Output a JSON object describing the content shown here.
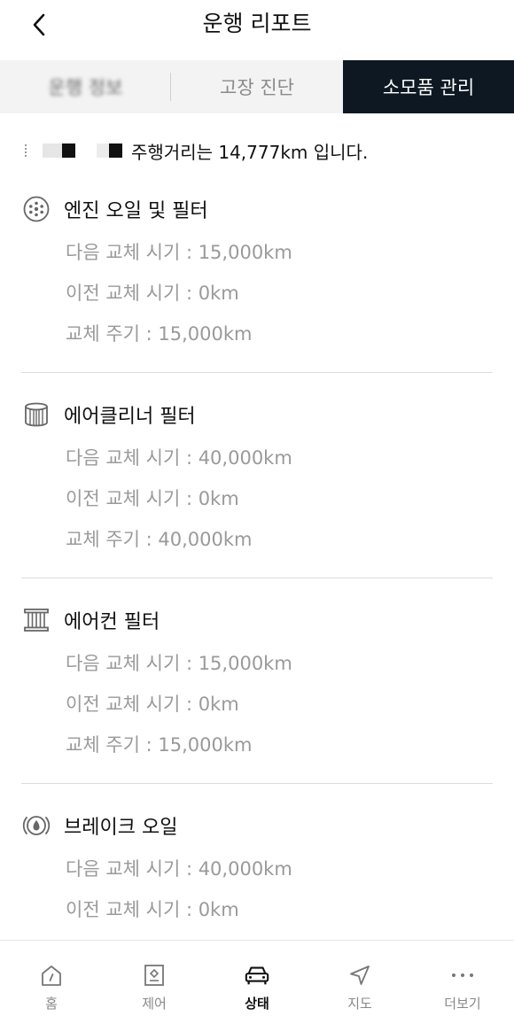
{
  "header": {
    "title": "운행 리포트"
  },
  "tabs": [
    {
      "label": "운행 정보",
      "active": false
    },
    {
      "label": "고장 진단",
      "active": false
    },
    {
      "label": "소모품 관리",
      "active": true
    }
  ],
  "mileage_text": "주행거리는 14,777km 입니다.",
  "items": [
    {
      "title": "엔진 오일 및 필터",
      "icon": "engine-oil-filter-icon",
      "next": "다음 교체 시기 : 15,000km",
      "prev": "이전 교체 시기 : 0km",
      "cycle": "교체 주기 : 15,000km"
    },
    {
      "title": "에어클리너 필터",
      "icon": "air-cleaner-filter-icon",
      "next": "다음 교체 시기 : 40,000km",
      "prev": "이전 교체 시기 : 0km",
      "cycle": "교체 주기 : 40,000km"
    },
    {
      "title": "에어컨 필터",
      "icon": "air-conditioner-filter-icon",
      "next": "다음 교체 시기 : 15,000km",
      "prev": "이전 교체 시기 : 0km",
      "cycle": "교체 주기 : 15,000km"
    },
    {
      "title": "브레이크 오일",
      "icon": "brake-oil-icon",
      "next": "다음 교체 시기 : 40,000km",
      "prev": "이전 교체 시기 : 0km"
    }
  ],
  "nav": [
    {
      "label": "홈",
      "icon": "home-icon",
      "active": false
    },
    {
      "label": "제어",
      "icon": "control-icon",
      "active": false
    },
    {
      "label": "상태",
      "icon": "car-status-icon",
      "active": true
    },
    {
      "label": "지도",
      "icon": "map-navigation-icon",
      "active": false
    },
    {
      "label": "더보기",
      "icon": "more-icon",
      "active": false
    }
  ],
  "colors": {
    "active_tab_bg": "#0d1822",
    "tab_bar_bg": "#f3f3f3",
    "detail_text": "#9a9a9a"
  }
}
